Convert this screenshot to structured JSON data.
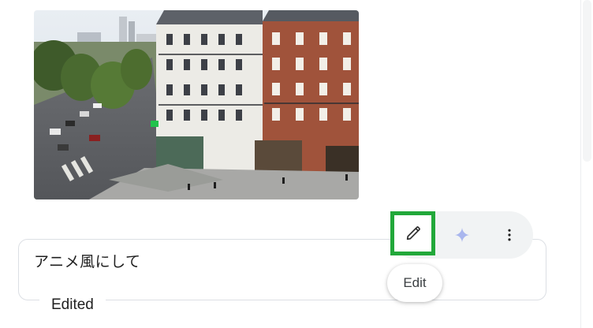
{
  "prompt": {
    "text": "アニメ風にして",
    "status": "Edited"
  },
  "toolbar": {
    "edit_icon": "pencil-icon",
    "sparkle_icon": "sparkle-icon",
    "more_icon": "more-vert-icon",
    "accent_color": "#22a83a",
    "sparkle_color": "#a9b6ee"
  },
  "tooltip": {
    "label": "Edit"
  },
  "image": {
    "subject": "paris-street-corner-photo"
  }
}
